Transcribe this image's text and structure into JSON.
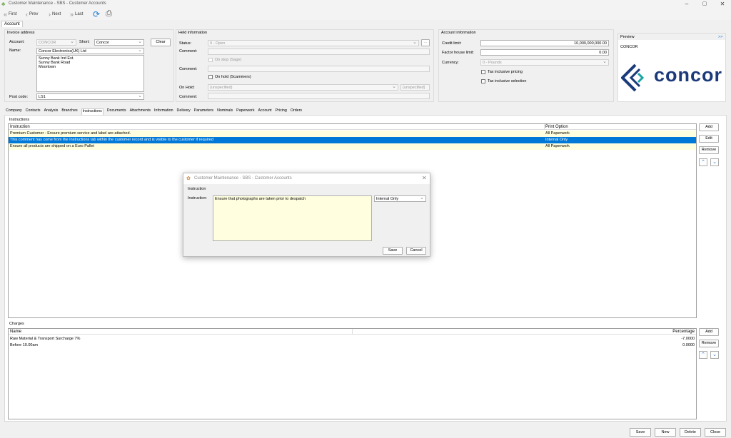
{
  "window": {
    "title": "Customer Maintenance - SBS - Customer Accounts",
    "minimize": "–",
    "maximize": "▢",
    "close": "✕"
  },
  "nav": {
    "first": "First",
    "prev": "Prev",
    "next": "Next",
    "last": "Last"
  },
  "top_tab": "Account",
  "invoice": {
    "section": "Invoice address",
    "account_label": "Account:",
    "account_value": "CONCOR",
    "short_label": "Short:",
    "short_value": "Concor",
    "clear": "Clear",
    "name_label": "Name:",
    "name_value": "Concor Electronics(UK) Ltd",
    "address_lines": [
      "Sunny Bank Ind Est.",
      "Sunny Bank Road",
      "Moortown"
    ],
    "postcode_label": "Post code:",
    "postcode_value": "LS1"
  },
  "held": {
    "section": "Held information",
    "status_label": "Status:",
    "status_value": "0 - Open",
    "ellipsis": "...",
    "comment_label": "Comment:",
    "on_stop": "On stop (Sage)",
    "comment2_label": "Comment:",
    "on_hold": "On hold (Scammers)",
    "comment3_label": "Comment:",
    "onhold_label": "On Hold:",
    "onhold_value": "(unspecified)",
    "onhold_extra": "(unspecified)",
    "comment4_label": "Comment:"
  },
  "account_info": {
    "section": "Account information",
    "credit_label": "Credit limit:",
    "credit_value": "10,000,000,000.00",
    "factor_label": "Factor house limit:",
    "factor_value": "0.00",
    "currency_label": "Currency:",
    "currency_value": "0 - Pounds",
    "tax_pricing": "Tax inclusive pricing",
    "tax_selection": "Tax inclusive selection"
  },
  "preview": {
    "title": "Preview",
    "expand": ">>",
    "account": "CONCOR",
    "logo_text": "concor"
  },
  "tabs": [
    "Company",
    "Contacts",
    "Analysis",
    "Branches",
    "Instructions",
    "Documents",
    "Attachments",
    "Information",
    "Delivery",
    "Parameters",
    "Nominals",
    "Paperwork",
    "Account",
    "Pricing",
    "Orders"
  ],
  "active_tab": "Instructions",
  "instructions": {
    "section": "Instructions",
    "col_instruction": "Instruction",
    "col_print": "Print Option",
    "rows": [
      {
        "instruction": "Premium Customer - Ensure premium service and label are attached.",
        "print": "All Paperwork"
      },
      {
        "instruction": "This comment has come from the Instructions tab within the customer record and is visible to the customer if required",
        "print": "Internal Only"
      },
      {
        "instruction": "Ensure all products are shipped on a Euro Pallet",
        "print": "All Paperwork"
      }
    ],
    "add": "Add",
    "edit": "Edit",
    "remove": "Remove"
  },
  "charges": {
    "section": "Charges",
    "col_name": "Name",
    "col_pct": "Percentage",
    "rows": [
      {
        "name": "Raw Material & Transport Surcharge 7%",
        "pct": "-7.0000"
      },
      {
        "name": "Before 10.00am",
        "pct": "0.0000"
      }
    ],
    "add": "Add",
    "remove": "Remove"
  },
  "dialog": {
    "title": "Customer Maintenance - SBS - Customer Accounts",
    "group": "Instruction",
    "label": "Instruction:",
    "text": "Ensure that photographs are taken prior to despatch",
    "option": "Internal Only",
    "save": "Save",
    "cancel": "Cancel",
    "close": "✕"
  },
  "bottom": {
    "save": "Save",
    "new": "New",
    "delete": "Delete",
    "close": "Close"
  },
  "colors": {
    "selected_row": "#0078d7",
    "highlight_row": "#ffffe0",
    "logo_blue": "#1b3a7a"
  }
}
